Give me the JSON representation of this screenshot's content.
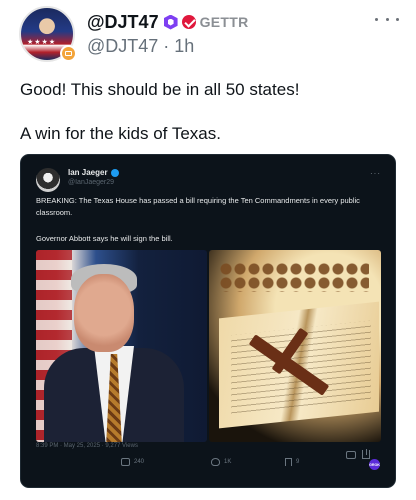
{
  "post": {
    "username": "@DJT47",
    "platform": "GETTR",
    "handle_time": "@DJT47 · 1h",
    "text_line1": "Good! This should be in all 50 states!",
    "text_line2": "A win for the kids of Texas.",
    "colors": {
      "verified": "#7e3ff2",
      "gettr": "#e0183c",
      "badge": "#f3a43a"
    }
  },
  "embedded_tweet": {
    "name": "Ian Jaeger",
    "handle": "@IanJaeger29",
    "more": "···",
    "text_1": "BREAKING: The Texas House has passed a bill requiring the Ten Commandments in every public classroom.",
    "text_2": "Governor Abbott says he will sign the bill.",
    "meta": "8:39 PM · May 25, 2025 · 9,277 Views",
    "retweets": "240",
    "likes": "1K",
    "bookmarks": "9",
    "badge": "GROK",
    "colors": {
      "background": "#0c131a",
      "verified": "#1d9bf0"
    }
  }
}
